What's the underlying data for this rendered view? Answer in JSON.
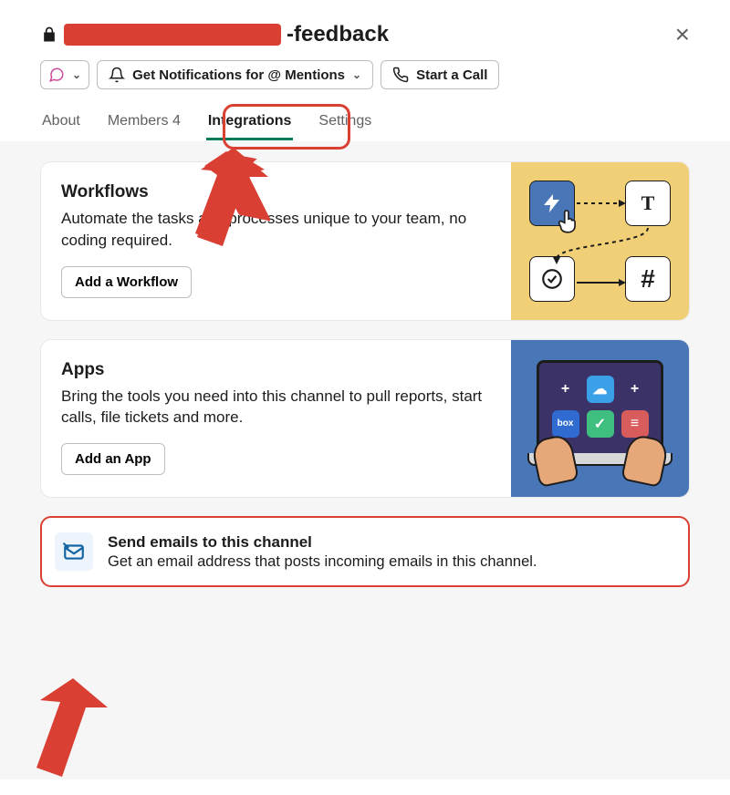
{
  "header": {
    "channel_suffix": "-feedback"
  },
  "actions": {
    "notifications_label": "Get Notifications for @ Mentions",
    "call_label": "Start a Call"
  },
  "tabs": {
    "about": "About",
    "members": "Members 4",
    "integrations": "Integrations",
    "settings": "Settings"
  },
  "workflows": {
    "title": "Workflows",
    "desc": "Automate the tasks and processes unique to your team, no coding required.",
    "button": "Add a Workflow"
  },
  "apps": {
    "title": "Apps",
    "desc": "Bring the tools you need into this channel to pull reports, start calls, file tickets and more.",
    "button": "Add an App"
  },
  "email": {
    "title": "Send emails to this channel",
    "desc": "Get an email address that posts incoming emails in this channel."
  }
}
